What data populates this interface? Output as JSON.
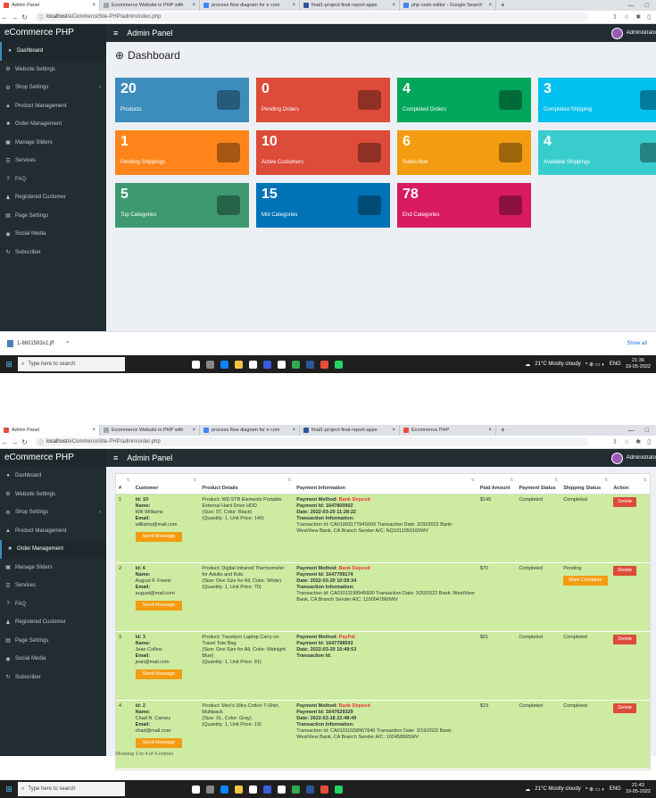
{
  "browser1": {
    "tabs": [
      {
        "label": "Admin Panel",
        "color": "#e74c3c",
        "active": true
      },
      {
        "label": "Ecommerce Website in PHP with",
        "color": "#9aa"
      },
      {
        "label": "process flow diagram for e com",
        "color": "#4285f4"
      },
      {
        "label": "final1-project-final-report-appe",
        "color": "#2b579a"
      },
      {
        "label": "php code editor - Google Search",
        "color": "#4285f4"
      }
    ],
    "url_host": "localhost",
    "url_path": "/eCommerceSite-PHP/admin/index.php"
  },
  "browser2": {
    "tabs": [
      {
        "label": "Admin Panel",
        "color": "#e74c3c",
        "active": true
      },
      {
        "label": "Ecommerce Website in PHP with",
        "color": "#9aa"
      },
      {
        "label": "process flow diagram for e com",
        "color": "#4285f4"
      },
      {
        "label": "final1-project-final-report-appe",
        "color": "#2b579a"
      },
      {
        "label": "Ecommerce PHP",
        "color": "#e74c3c"
      }
    ],
    "url_host": "localhost",
    "url_path": "/eCommerceSite-PHP/admin/order.php"
  },
  "header": {
    "brand": "eCommerce PHP",
    "title": "Admin Panel",
    "user": "Administrato"
  },
  "sidebar": {
    "items": [
      {
        "label": "Dashboard",
        "icon": "●"
      },
      {
        "label": "Website Settings",
        "icon": "⚙"
      },
      {
        "label": "Shop Settings",
        "icon": "⚙",
        "chevron": "›"
      },
      {
        "label": "Product Management",
        "icon": "▲"
      },
      {
        "label": "Order Management",
        "icon": "■"
      },
      {
        "label": "Manage Sliders",
        "icon": "▣"
      },
      {
        "label": "Services",
        "icon": "☰"
      },
      {
        "label": "FAQ",
        "icon": "?"
      },
      {
        "label": "Registered Customer",
        "icon": "♟"
      },
      {
        "label": "Page Settings",
        "icon": "▤"
      },
      {
        "label": "Social Media",
        "icon": "◉"
      },
      {
        "label": "Subscriber",
        "icon": "↻"
      }
    ]
  },
  "dashboard": {
    "title": "Dashboard",
    "boxes": [
      {
        "num": "20",
        "label": "Products",
        "color": "#3c8dbc"
      },
      {
        "num": "0",
        "label": "Pending Orders",
        "color": "#dd4b39"
      },
      {
        "num": "4",
        "label": "Completed Orders",
        "color": "#00a65a"
      },
      {
        "num": "3",
        "label": "Completed Shipping",
        "color": "#00c0ef"
      },
      {
        "num": "1",
        "label": "Pending Shippings",
        "color": "#ff851b"
      },
      {
        "num": "10",
        "label": "Active Customers",
        "color": "#dd4b39"
      },
      {
        "num": "6",
        "label": "Subscriber",
        "color": "#f39c12"
      },
      {
        "num": "4",
        "label": "Available Shippings",
        "color": "#39cccc"
      },
      {
        "num": "5",
        "label": "Top Categories",
        "color": "#3d9970"
      },
      {
        "num": "15",
        "label": "Mid Categories",
        "color": "#0073b7"
      },
      {
        "num": "78",
        "label": "End Categories",
        "color": "#d81b60"
      }
    ]
  },
  "download": {
    "file": "1-8601583x2.jff",
    "show_all": "Show all"
  },
  "taskbar": {
    "search": "Type here to search",
    "weather": "21°C Mostly cloudy",
    "lang": "ENG",
    "time1": "21:36",
    "date1": "19-05-2022",
    "time2": "21:43",
    "date2": "19-05-2022"
  },
  "orders": {
    "headers": [
      "#",
      "Customer",
      "Product Details",
      "Payment Information",
      "Paid Amount",
      "Payment Status",
      "Shipping Status",
      "Action"
    ],
    "rows": [
      {
        "num": "1",
        "cust_id": "Id: 10",
        "cust_name_lbl": "Name:",
        "cust_name": "Will Williams",
        "cust_email_lbl": "Email:",
        "cust_email": "williams@mail.com",
        "product": "Product: WD 5TB Elements Portable External Hard Drive HDD",
        "size": "(Size: 5T, Color: Black)",
        "qty": "(Quantity: 1, Unit Price: 149)",
        "pay_method_lbl": "Payment Method:",
        "pay_method": "Bank Deposit",
        "pay_id": "Payment Id: 1647800902",
        "pay_date": "Date: 2022-03-20 11:28:22",
        "tx_lbl": "Transaction Information:",
        "tx": "Transaction Id: CA0100317794S009 Transaction Date: 3/20/2022 Bank: WestView Bank, CA Branch Sender A/C: NQ1011050160WV",
        "amount": "$149",
        "pay_status": "Completed",
        "ship_status": "Completed",
        "mark": ""
      },
      {
        "num": "2",
        "cust_id": "Id: 6",
        "cust_name_lbl": "Name:",
        "cust_name": "August F. Freels",
        "cust_email_lbl": "Email:",
        "cust_email": "august@mail.com",
        "product": "Product: Digital Infrared Thermometer for Adults and Kids",
        "size": "(Size: One Size for All, Color: White)",
        "qty": "(Quantity: 1, Unit Price: 70)",
        "pay_method_lbl": "Payment Method:",
        "pay_method": "Bank Deposit",
        "pay_id": "Payment Id: 1647799174",
        "pay_date": "Date: 2022-03-20 10:59:34",
        "tx_lbl": "Transaction Information:",
        "tx": "Transaction Id: CA01011198945600 Transaction Date: 3/20/2022 Bank: WestView Bank, CA Branch Sender A/C: 1100047860WV",
        "amount": "$70",
        "pay_status": "Completed",
        "ship_status": "Pending",
        "mark": "Mark Complete"
      },
      {
        "num": "3",
        "cust_id": "Id: 3",
        "cust_name_lbl": "Name:",
        "cust_name": "Jean Collins",
        "cust_email_lbl": "Email:",
        "cust_email": "jean@mail.com",
        "product": "Product: Travelpro Laptop Carry-on Travel Tote Bag",
        "size": "(Size: One Size for All, Color: Midnight Blue)",
        "qty": "(Quantity: 1, Unit Price: 91)",
        "pay_method_lbl": "Payment Method:",
        "pay_method": "PayPal",
        "pay_id": "Payment Id: 1647798593",
        "pay_date": "Date: 2022-03-20 10:49:53",
        "tx_lbl": "Transaction Id:",
        "tx": "",
        "amount": "$91",
        "pay_status": "Completed",
        "ship_status": "Completed",
        "mark": ""
      },
      {
        "num": "4",
        "cust_id": "Id: 2",
        "cust_name_lbl": "Name:",
        "cust_name": "Chad N. Carney",
        "cust_email_lbl": "Email:",
        "cust_email": "chad@mail.com",
        "product": "Product: Men's Ultra Cotton T-Shirt, Multipack",
        "size": "(Size: XL, Color: Gray)",
        "qty": "(Quantity: 1, Unit Price: 19)",
        "pay_method_lbl": "Payment Method:",
        "pay_method": "Bank Deposit",
        "pay_id": "Payment Id: 1647629329",
        "pay_date": "Date: 2022-03-18 22:48:49",
        "tx_lbl": "Transaction Information:",
        "tx": "Transaction Id: CA01010158967840 Transaction Date: 3/19/2022 Bank: WestView Bank, CA Branch Sender A/C: 102458965WV",
        "amount": "$19",
        "pay_status": "Completed",
        "ship_status": "Completed",
        "mark": ""
      }
    ],
    "send_message": "Send Message",
    "delete": "Delete",
    "showing": "Showing 1 to 4 of 4 entries"
  }
}
